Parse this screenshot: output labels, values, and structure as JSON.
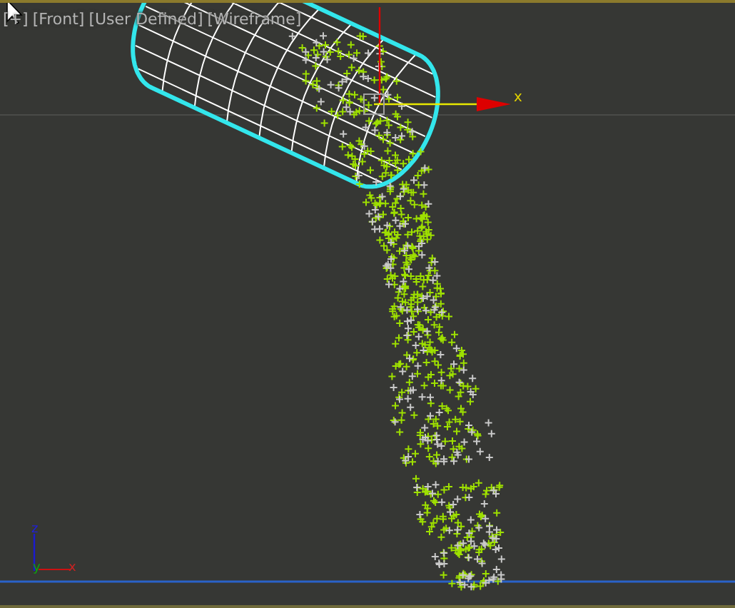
{
  "viewport": {
    "labels": [
      {
        "text": "[+]"
      },
      {
        "text": "[Front]"
      },
      {
        "text": "[User Defined]"
      },
      {
        "text": "[Wireframe]"
      }
    ],
    "gizmo_axis": "x",
    "axis_triad": {
      "z": "z",
      "y": "y",
      "x": "x"
    }
  }
}
